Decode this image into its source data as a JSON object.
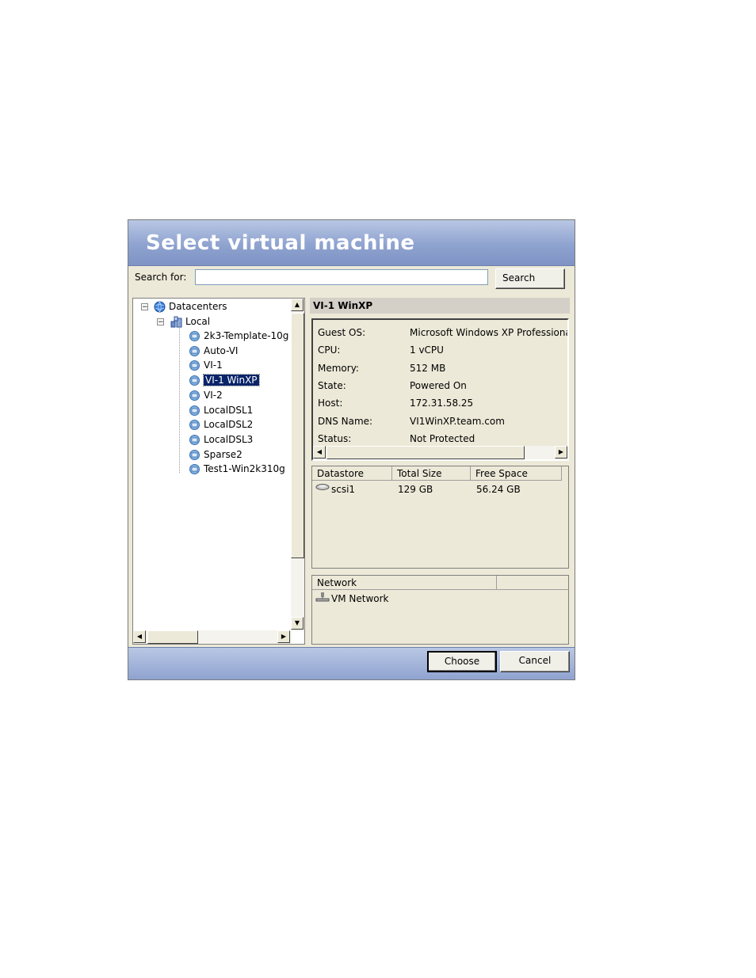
{
  "dialog": {
    "title": "Select virtual machine",
    "search_label": "Search for:",
    "search_value": "",
    "search_button": "Search"
  },
  "tree": {
    "root": "Datacenters",
    "datacenter": "Local",
    "vms": [
      "2k3-Template-10g",
      "Auto-VI",
      "VI-1",
      "VI-1 WinXP",
      "VI-2",
      "LocalDSL1",
      "LocalDSL2",
      "LocalDSL3",
      "Sparse2",
      "Test1-Win2k310g"
    ],
    "selected": "VI-1 WinXP"
  },
  "details": {
    "vm_name": "VI-1 WinXP",
    "properties": [
      {
        "key": "Guest OS:",
        "value": "Microsoft Windows XP Professional ("
      },
      {
        "key": "CPU:",
        "value": "1 vCPU"
      },
      {
        "key": "Memory:",
        "value": "512 MB"
      },
      {
        "key": "State:",
        "value": "Powered On"
      },
      {
        "key": "Host:",
        "value": "172.31.58.25"
      },
      {
        "key": "DNS Name:",
        "value": "VI1WinXP.team.com"
      },
      {
        "key": "Status:",
        "value": "Not Protected"
      }
    ]
  },
  "datastores": {
    "columns": [
      "Datastore",
      "Total Size",
      "Free Space"
    ],
    "rows": [
      {
        "name": "scsi1",
        "total": "129 GB",
        "free": "56.24 GB"
      }
    ]
  },
  "networks": {
    "columns": [
      "Network"
    ],
    "rows": [
      "VM Network"
    ]
  },
  "footer": {
    "choose": "Choose",
    "cancel": "Cancel"
  },
  "colors": {
    "title_bar": "#8fa3d0",
    "selection": "#0a246a",
    "dialog_bg": "#ece9d8"
  }
}
